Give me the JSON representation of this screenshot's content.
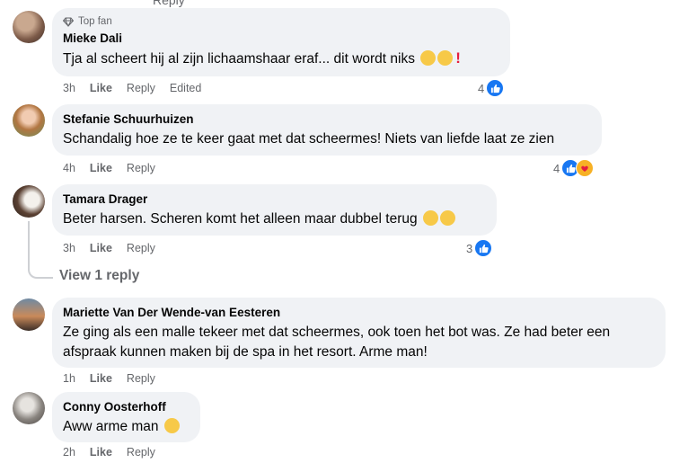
{
  "top_cut": {
    "reply_label": "Reply"
  },
  "comments": [
    {
      "badge": "Top fan",
      "author": "Mieke Dali",
      "text": "Tja al scheert hij al zijn lichaamshaar eraf... dit wordt niks",
      "time": "3h",
      "like": "Like",
      "reply": "Reply",
      "edited": "Edited",
      "reaction_count": "4"
    },
    {
      "author": "Stefanie Schuurhuizen",
      "text": "Schandalig hoe ze te keer gaat met dat scheermes! Niets van liefde laat ze zien",
      "time": "4h",
      "like": "Like",
      "reply": "Reply",
      "reaction_count": "4"
    },
    {
      "author": "Tamara Drager",
      "text": "Beter harsen. Scheren komt het alleen maar dubbel terug",
      "time": "3h",
      "like": "Like",
      "reply": "Reply",
      "reaction_count": "3",
      "view_replies": "View 1 reply"
    },
    {
      "author": "Mariette Van Der Wende-van Eesteren",
      "text": "Ze ging als een malle tekeer met dat scheermes, ook toen het bot was. Ze had beter een afspraak kunnen maken bij de spa in het resort. Arme man!",
      "time": "1h",
      "like": "Like",
      "reply": "Reply"
    },
    {
      "author": "Conny Oosterhoff",
      "text": "Aww arme man",
      "time": "2h",
      "like": "Like",
      "reply": "Reply"
    }
  ],
  "colors": {
    "like_blue": "#1877f2",
    "bubble": "#f0f2f5",
    "meta": "#65676b"
  }
}
